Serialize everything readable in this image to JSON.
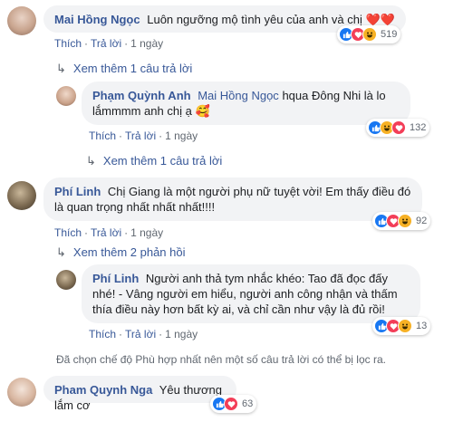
{
  "comments": [
    {
      "author": "Mai Hồng Ngọc",
      "text": "Luôn ngưỡng mộ tình yêu của anh và chị",
      "emoji": "❤️❤️",
      "reactions": [
        "like-icon",
        "love-icon",
        "haha-icon"
      ],
      "reaction_count": "519",
      "actions": {
        "like": "Thích",
        "reply": "Trả lời",
        "time": "1 ngày"
      }
    },
    {
      "more_label": "Xem thêm 1 câu trả lời",
      "author": "Phạm Quỳnh Anh",
      "mention": "Mai Hồng Ngọc",
      "text": "hqua Đông Nhi là lo lắmmmm anh chị ạ",
      "emoji": "🥰",
      "reactions": [
        "like-icon",
        "haha-icon",
        "love-icon"
      ],
      "reaction_count": "132",
      "actions": {
        "like": "Thích",
        "reply": "Trả lời",
        "time": "1 ngày"
      }
    },
    {
      "more_label": "Xem thêm 1 câu trả lời",
      "author": "Phí Linh",
      "text": "Chị Giang là một người phụ nữ tuyệt vời! Em thấy điều đó là quan trọng nhất nhất nhất!!!!",
      "reactions": [
        "like-icon",
        "love-icon",
        "haha-icon"
      ],
      "reaction_count": "92",
      "actions": {
        "like": "Thích",
        "reply": "Trả lời",
        "time": "1 ngày"
      }
    },
    {
      "more_label": "Xem thêm 2 phản hồi",
      "author": "Phí Linh",
      "text": "Người anh thả tym nhắc khéo: Tao đã đọc đấy nhé! - Vâng người em hiểu, người anh công nhận và thấm thía điều này hơn bất kỳ ai, và chỉ cần như vậy là đủ rồi!",
      "reactions": [
        "like-icon",
        "love-icon",
        "haha-icon"
      ],
      "reaction_count": "13",
      "actions": {
        "like": "Thích",
        "reply": "Trả lời",
        "time": "1 ngày"
      }
    },
    {
      "author": "Pham Quynh Nga",
      "text": "Yêu thương lắm cơ",
      "reactions": [
        "like-icon",
        "love-icon"
      ],
      "reaction_count": "63"
    }
  ],
  "filter_note": "Đã chọn chế độ Phù hợp nhất nên một số câu trả lời có thể bị lọc ra.",
  "colors": {
    "link": "#385898",
    "bubble": "#f2f3f5",
    "meta": "#606770",
    "like": "#1877f2",
    "love": "#f33e58",
    "haha": "#f7b125"
  }
}
